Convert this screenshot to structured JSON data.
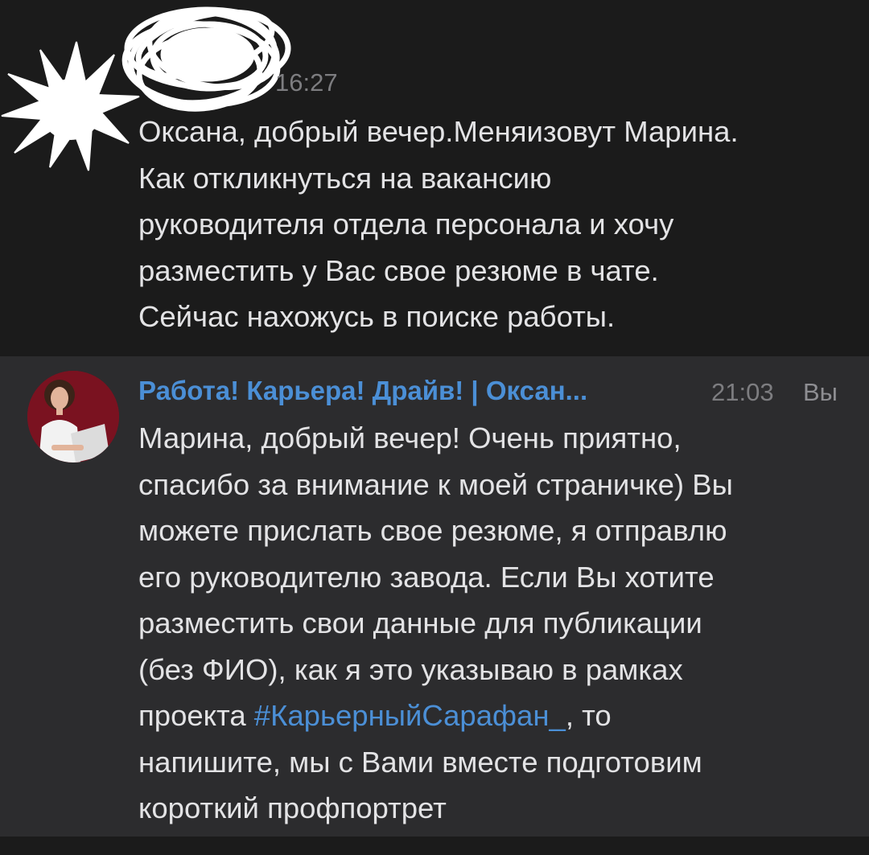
{
  "messages": [
    {
      "author": "",
      "time": "16:27",
      "lines": [
        "Оксана, добрый вечер.Меняизовут Марина.",
        "Как откликнуться на вакансию",
        "руководителя отдела персонала и хочу",
        "разместить у Вас свое резюме в чате.",
        "Сейчас нахожусь в поиске работы."
      ]
    },
    {
      "author": "Работа! Карьера! Драйв! | Оксан...",
      "time": "21:03",
      "you_label": "Вы",
      "lines": [
        "Марина, добрый вечер! Очень приятно,",
        "спасибо за внимание к моей страничке) Вы",
        "можете прислать свое резюме, я отправлю",
        "его руководителю завода. Если Вы хотите",
        "разместить свои данные для публикации",
        "(без ФИО), как я это указываю в рамках"
      ],
      "line7_before": "проекта ",
      "hashtag": "#КарьерныйСарафан_",
      "line7_after": ", то",
      "lines_end": [
        "напишите, мы с Вами вместе подготовим",
        "короткий профпортрет"
      ]
    }
  ],
  "colors": {
    "background": "#1b1b1b",
    "highlight_row": "#2c2c2e",
    "link": "#4b8fd6",
    "text": "#e3e3e5",
    "time": "#7d7d80"
  },
  "icons": [
    "starburst-redaction-icon",
    "scribble-redaction-icon",
    "sender-avatar-photo"
  ]
}
